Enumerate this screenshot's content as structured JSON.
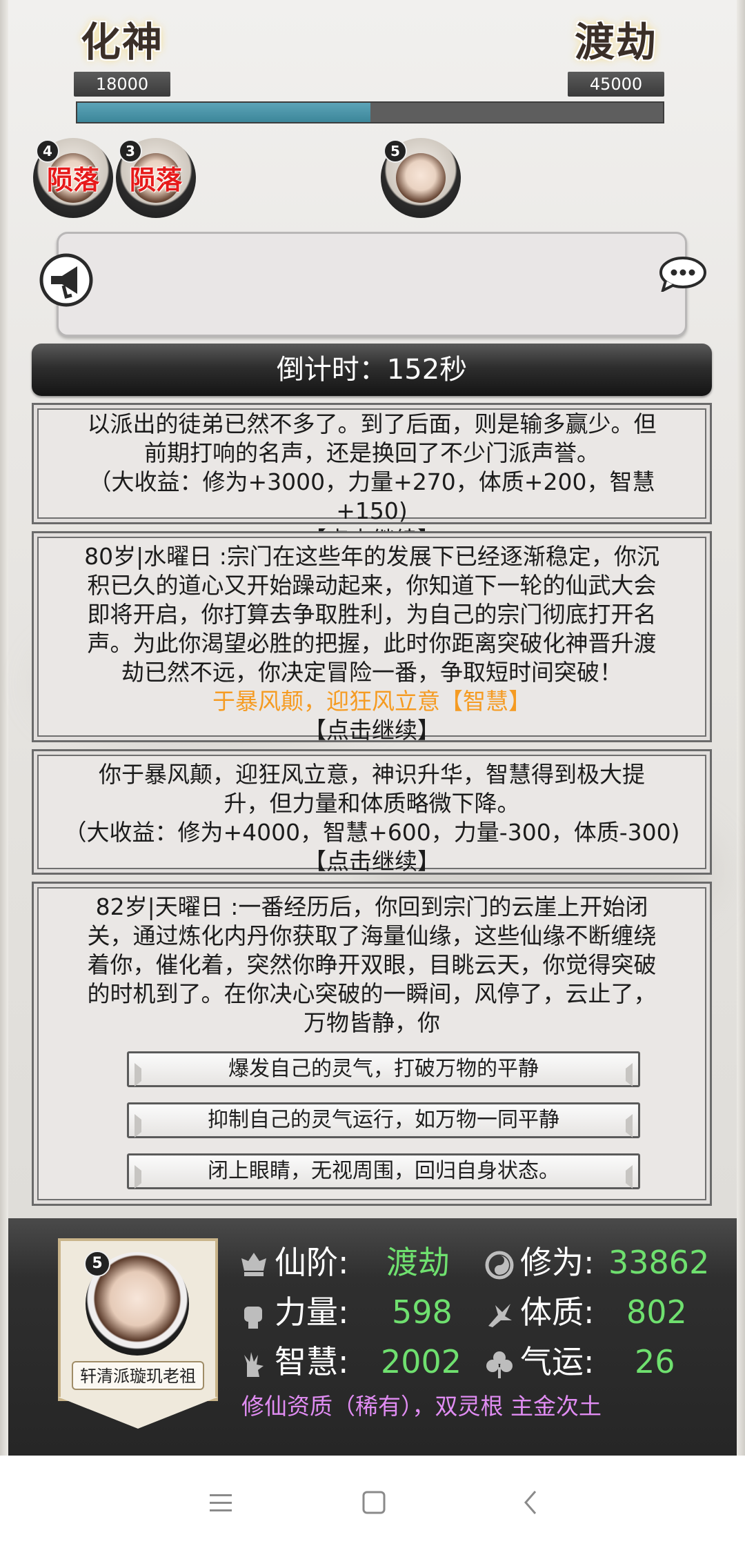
{
  "header": {
    "current_realm": "化神",
    "current_realm_value": "18000",
    "next_realm": "渡劫",
    "next_realm_value": "45000",
    "progress": 0.5
  },
  "avatars": [
    {
      "level": "4",
      "status": "陨落"
    },
    {
      "level": "3",
      "status": "陨落"
    },
    {
      "level": "5",
      "status": ""
    }
  ],
  "countdown": "倒计时：152秒",
  "cards": [
    {
      "lines": [
        "以派出的徒弟已然不多了。到了后面，则是输多赢少。但",
        "前期打响的名声，还是换回了不少门派声誉。",
        "（大收益：修为+3000，力量+270，体质+200，智慧+150)"
      ],
      "continue": "【点击继续】"
    },
    {
      "lines": [
        "80岁|水曜日 :宗门在这些年的发展下已经逐渐稳定，你沉",
        "积已久的道心又开始躁动起来，你知道下一轮的仙武大会",
        "即将开启，你打算去争取胜利，为自己的宗门彻底打开名",
        "声。为此你渴望必胜的把握，此时你距离突破化神晋升渡",
        "劫已然不远，你决定冒险一番，争取短时间突破！"
      ],
      "choice": "于暴风颠，迎狂风立意【智慧】",
      "continue": "【点击继续】"
    },
    {
      "lines": [
        "你于暴风颠，迎狂风立意，神识升华，智慧得到极大提",
        "升，但力量和体质略微下降。",
        "（大收益：修为+4000，智慧+600，力量-300，体质-300)"
      ],
      "continue": "【点击继续】"
    },
    {
      "lines": [
        "82岁|天曜日 :一番经历后，你回到宗门的云崖上开始闭",
        "关，通过炼化内丹你获取了海量仙缘，这些仙缘不断缠绕",
        "着你，催化着，突然你睁开双眼，目眺云天，你觉得突破",
        "的时机到了。在你决心突破的一瞬间，风停了，云止了，",
        "万物皆静，你"
      ],
      "options": [
        "爆发自己的灵气，打破万物的平静",
        "抑制自己的灵气运行，如万物一同平静",
        "闭上眼睛，无视周围，回归自身状态。"
      ]
    }
  ],
  "character": {
    "level": "5",
    "title": "轩清派璇玑老祖",
    "stats": [
      {
        "icon": "rank-icon",
        "label": "仙阶:",
        "value": "渡劫"
      },
      {
        "icon": "cultivation-icon",
        "label": "修为:",
        "value": "33862"
      },
      {
        "icon": "fist-icon",
        "label": "力量:",
        "value": "598"
      },
      {
        "icon": "body-icon",
        "label": "体质:",
        "value": "802"
      },
      {
        "icon": "wisdom-icon",
        "label": "智慧:",
        "value": "2002"
      },
      {
        "icon": "luck-icon",
        "label": "气运:",
        "value": "26"
      }
    ],
    "aptitude": "修仙资质（稀有），双灵根 主金次土"
  },
  "colors": {
    "stat_value": "#6fe06f",
    "choice": "#f59b22",
    "aptitude": "#e08cf2",
    "fallen": "#e61a1a",
    "progress": "#4b95a9"
  }
}
